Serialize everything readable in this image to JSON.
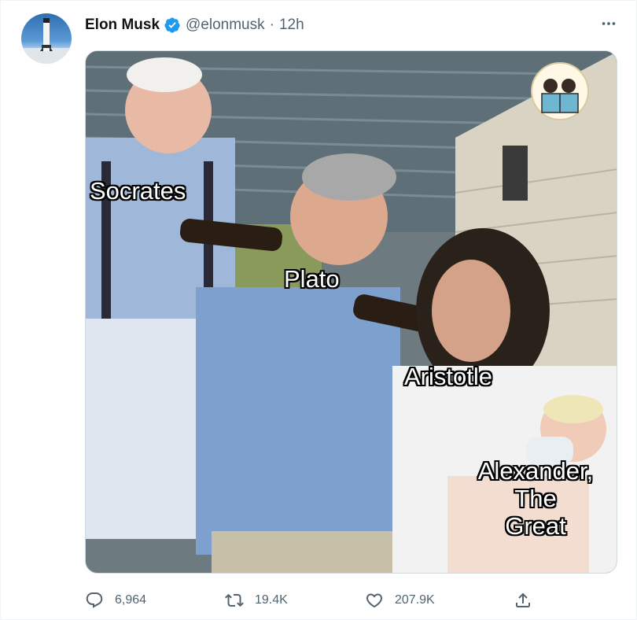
{
  "author": {
    "name": "Elon Musk",
    "handle": "@elonmusk",
    "separator": "·",
    "time": "12h",
    "verified": true
  },
  "icons": {
    "avatar": "avatar-rocket",
    "verified": "verified-badge-icon",
    "more": "more-horizontal-icon",
    "reply": "reply-icon",
    "retweet": "retweet-icon",
    "like": "heart-icon",
    "share": "share-icon"
  },
  "colors": {
    "verified": "#1d9bf0",
    "secondary_text": "#536471",
    "primary_text": "#0f1419"
  },
  "meme": {
    "labels": {
      "socrates": "Socrates",
      "plato": "Plato",
      "aristotle": "Aristotle",
      "alexander": "Alexander,\nThe\nGreat"
    }
  },
  "actions": {
    "replies": "6,964",
    "retweets": "19.4K",
    "likes": "207.9K"
  }
}
